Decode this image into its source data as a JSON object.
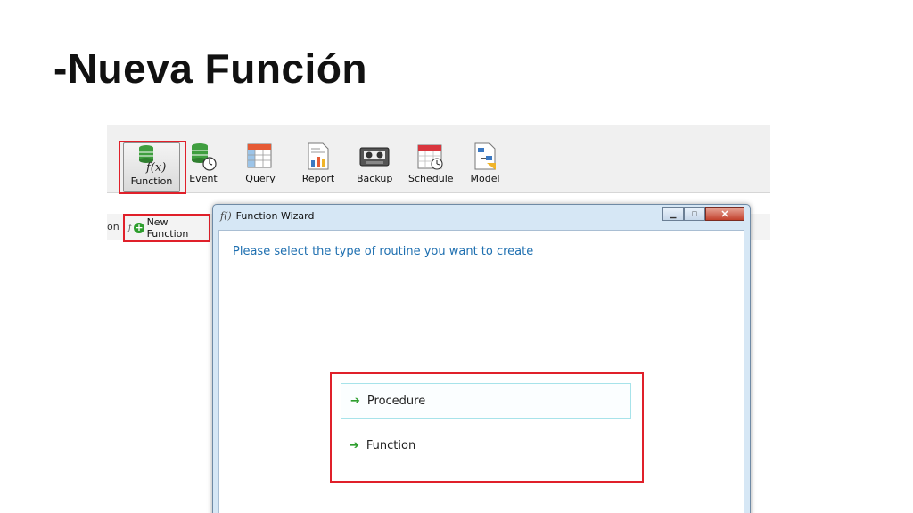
{
  "slide": {
    "title": "-Nueva Función"
  },
  "toolbar": {
    "buttons": [
      {
        "label": "Function"
      },
      {
        "label": "Event"
      },
      {
        "label": "Query"
      },
      {
        "label": "Report"
      },
      {
        "label": "Backup"
      },
      {
        "label": "Schedule"
      },
      {
        "label": "Model"
      }
    ]
  },
  "subbar": {
    "edge_text": "on",
    "new_function_label": "New Function"
  },
  "wizard": {
    "title": "Function Wizard",
    "prompt": "Please select the type of routine you want to create",
    "options": [
      {
        "label": "Procedure"
      },
      {
        "label": "Function"
      }
    ]
  },
  "colors": {
    "highlight": "#e0202a",
    "accent_blue": "#1e6fb0",
    "arrow_green": "#2e9e2e"
  }
}
